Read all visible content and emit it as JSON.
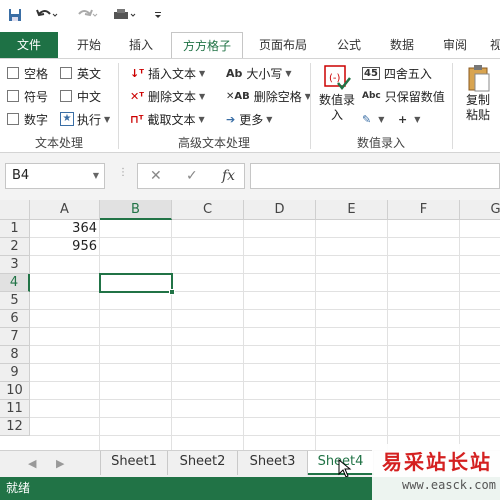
{
  "qat": {
    "icons": [
      "save-icon",
      "undo-icon",
      "redo-icon",
      "print-icon",
      "customize-icon"
    ]
  },
  "tabs": {
    "file": "文件",
    "items": [
      "开始",
      "插入",
      "方方格子",
      "页面布局",
      "公式",
      "数据",
      "审阅",
      "视"
    ],
    "active": "方方格子"
  },
  "ribbon": {
    "text_group": {
      "label": "文本处理",
      "checkboxes": [
        "空格",
        "英文",
        "符号",
        "中文",
        "数字"
      ],
      "execute": "执行"
    },
    "advanced_group": {
      "label": "高级文本处理",
      "insert_text": "插入文本",
      "delete_text": "删除文本",
      "extract_text": "截取文本",
      "case": "大小写",
      "delete_spaces": "删除空格",
      "more": "更多"
    },
    "numeric_group": {
      "label": "数值录入",
      "value_entry": "数值录入",
      "round": "四舍五入",
      "keep_value": "只保留数值"
    },
    "paste_group": {
      "label": "复制粘贴"
    }
  },
  "formula_bar": {
    "name_box": "B4",
    "cancel": "✕",
    "enter": "✓",
    "fx": "fx",
    "content": ""
  },
  "grid": {
    "columns": [
      "A",
      "B",
      "C",
      "D",
      "E",
      "F",
      "G"
    ],
    "rows": [
      "1",
      "2",
      "3",
      "4",
      "5",
      "6",
      "7",
      "8",
      "9",
      "10",
      "11",
      "12"
    ],
    "selected_column": "B",
    "selected_row": "4",
    "cells": {
      "A1": "364",
      "A2": "956"
    }
  },
  "sheets": {
    "tabs": [
      "Sheet1",
      "Sheet2",
      "Sheet3",
      "Sheet4"
    ],
    "active": "Sheet4"
  },
  "status": {
    "text": "就绪"
  },
  "watermark": {
    "text": "易采站长站",
    "url": "www.easck.com"
  },
  "colors": {
    "accent": "#217346",
    "file_tab": "#1e7145",
    "watermark": "#d42020"
  }
}
